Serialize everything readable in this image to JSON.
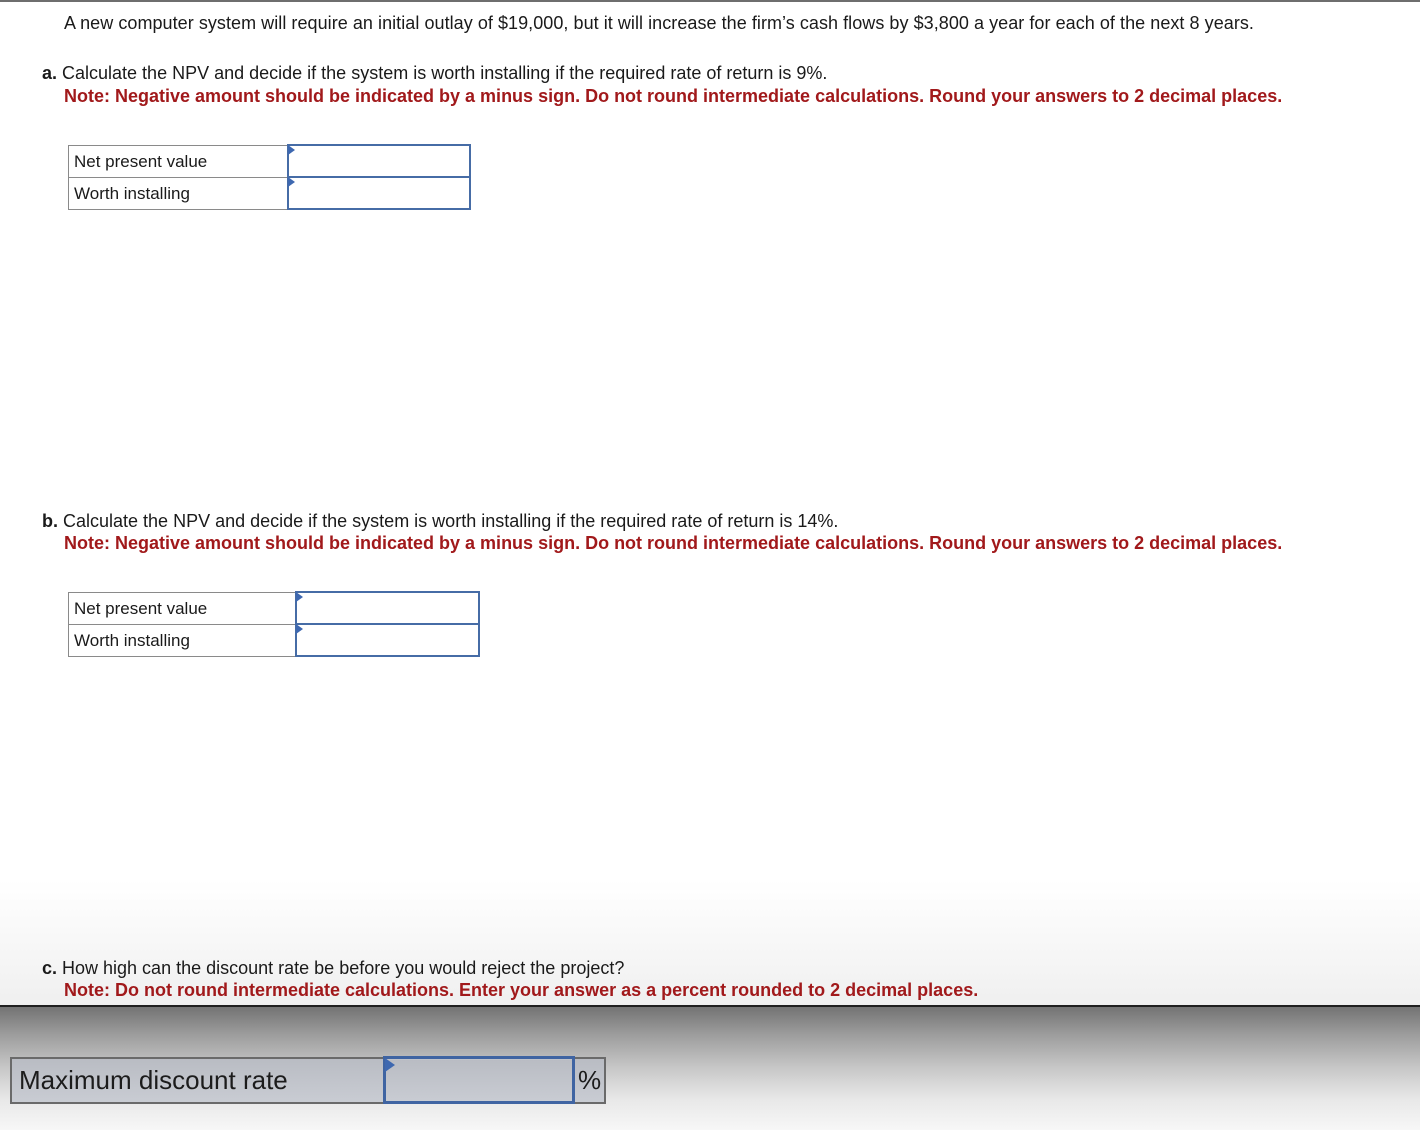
{
  "problem": {
    "intro": "A new computer system will require an initial outlay of $19,000, but it will increase the firm’s cash flows by $3,800 a year for each of the next 8 years."
  },
  "parts": {
    "a": {
      "letter": "a.",
      "question": " Calculate the NPV and decide if the system is worth installing if the required rate of return is 9%.",
      "note": "Note: Negative amount should be indicated by a minus sign. Do not round intermediate calculations. Round your answers to 2 decimal places.",
      "rows": [
        {
          "label": "Net present value",
          "value": ""
        },
        {
          "label": "Worth installing",
          "value": ""
        }
      ]
    },
    "b": {
      "letter": "b.",
      "question": " Calculate the NPV and decide if the system is worth installing if the required rate of return is 14%.",
      "note": "Note: Negative amount should be indicated by a minus sign. Do not round intermediate calculations. Round your answers to 2 decimal places.",
      "rows": [
        {
          "label": "Net present value",
          "value": ""
        },
        {
          "label": "Worth installing",
          "value": ""
        }
      ]
    },
    "c": {
      "letter": "c.",
      "question": " How high can the discount rate be before you would reject the project?",
      "note": "Note: Do not round intermediate calculations. Enter your answer as a percent rounded to 2 decimal places.",
      "row": {
        "label": "Maximum discount rate",
        "value": "",
        "unit": "%"
      }
    }
  },
  "colors": {
    "note_red": "#a1191b",
    "input_border_blue": "#466ca6",
    "flag_blue": "#3e68b0"
  }
}
